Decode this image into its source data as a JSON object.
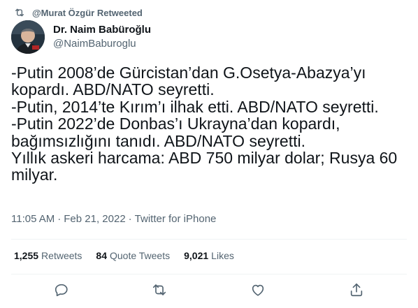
{
  "social_context": {
    "text": "@Murat Özgür Retweeted",
    "icon": "retweet-icon"
  },
  "author": {
    "display_name": "Dr. Naim Babüroğlu",
    "handle": "@NaimBaburoglu"
  },
  "tweet": {
    "lines": [
      "-Putin 2008’de Gürcistan’dan G.Osetya-Abazya’yı",
      "kopardı. ABD/NATO seyretti.",
      "-Putin, 2014’te Kırım’ı ilhak etti. ABD/NATO seyretti.",
      "-Putin 2022’de Donbas’ı Ukrayna’dan kopardı,",
      "bağımsızlığını tanıdı. ABD/NATO seyretti.",
      "Yıllık askeri harcama: ABD 750 milyar dolar; Rusya 60",
      "milyar."
    ]
  },
  "meta": {
    "time": "11:05 AM",
    "sep1": "·",
    "date": "Feb 21, 2022",
    "sep2": "·",
    "source": "Twitter for iPhone"
  },
  "stats": {
    "retweets": {
      "count": "1,255",
      "label": "Retweets"
    },
    "quotes": {
      "count": "84",
      "label": "Quote Tweets"
    },
    "likes": {
      "count": "9,021",
      "label": "Likes"
    }
  },
  "actions": [
    "reply-icon",
    "retweet-icon",
    "like-icon",
    "share-icon"
  ],
  "colors": {
    "text": "#0f1419",
    "secondary": "#536471",
    "divider": "#eff3f4"
  }
}
